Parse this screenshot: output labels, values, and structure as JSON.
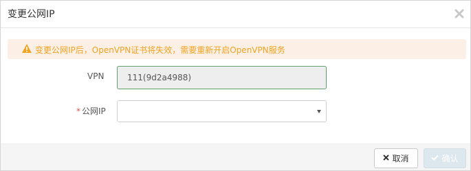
{
  "dialog": {
    "title": "变更公网IP",
    "close_icon": "close-icon"
  },
  "alert": {
    "icon": "warning-icon",
    "message": "变更公网IP后，OpenVPN证书将失效，需要重新开启OpenVPN服务",
    "color": "#f0a422",
    "background": "#fcefe6"
  },
  "form": {
    "vpn": {
      "label": "VPN",
      "value": "111(9d2a4988)"
    },
    "public_ip": {
      "required_mark": "*",
      "label": "公网IP",
      "selected_value": ""
    }
  },
  "footer": {
    "cancel": {
      "icon": "times-icon",
      "label": "取消"
    },
    "confirm": {
      "icon": "check-icon",
      "label": "确认"
    }
  }
}
